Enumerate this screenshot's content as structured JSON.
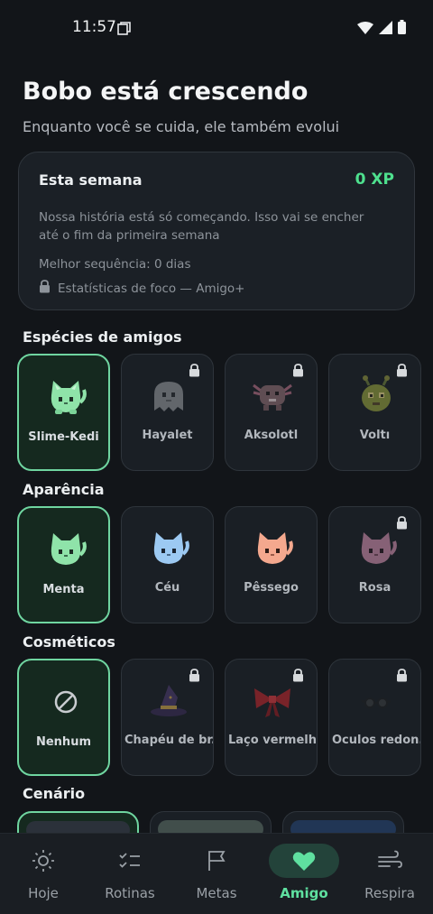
{
  "status_bar": {
    "time": "11:57"
  },
  "header": {
    "title": "Bobo está crescendo",
    "subtitle": "Enquanto você se cuida, ele também evolui"
  },
  "week_card": {
    "title": "Esta semana",
    "xp": "0 XP",
    "description": "Nossa história está só começando. Isso vai se encher até o fim da primeira semana",
    "streak": "Melhor sequência: 0 dias",
    "locked_feature": "Estatísticas de foco — Amigo+"
  },
  "sections": {
    "species": "Espécies de amigos",
    "appearance": "Aparência",
    "cosmetics": "Cosméticos",
    "scenery": "Cenário"
  },
  "species": [
    {
      "label": "Slime-Kedi",
      "icon": "green-cat-icon",
      "selected": true,
      "locked": false
    },
    {
      "label": "Hayalet",
      "icon": "ghost-icon",
      "selected": false,
      "locked": true
    },
    {
      "label": "Aksolotl",
      "icon": "axolotl-icon",
      "selected": false,
      "locked": true
    },
    {
      "label": "Voltı",
      "icon": "alien-icon",
      "selected": false,
      "locked": true
    }
  ],
  "appearance": [
    {
      "label": "Menta",
      "icon": "mint-cat-icon",
      "selected": true,
      "locked": false,
      "color": "#8fe3a9"
    },
    {
      "label": "Céu",
      "icon": "sky-cat-icon",
      "selected": false,
      "locked": false,
      "color": "#9cc9f2"
    },
    {
      "label": "Pêssego",
      "icon": "peach-cat-icon",
      "selected": false,
      "locked": false,
      "color": "#f4a88e"
    },
    {
      "label": "Rosa",
      "icon": "rose-cat-icon",
      "selected": false,
      "locked": true,
      "color": "#c98aa8"
    }
  ],
  "cosmetics": [
    {
      "label": "Nenhum",
      "icon": "none-icon",
      "selected": true,
      "locked": false
    },
    {
      "label": "Chapéu de br...",
      "icon": "witch-hat-icon",
      "selected": false,
      "locked": true
    },
    {
      "label": "Laço vermelho",
      "icon": "red-bow-icon",
      "selected": false,
      "locked": true
    },
    {
      "label": "Óculos redon...",
      "icon": "round-glasses-icon",
      "selected": false,
      "locked": true
    }
  ],
  "nav": [
    {
      "label": "Hoje",
      "icon": "sun-icon",
      "active": false
    },
    {
      "label": "Rotinas",
      "icon": "checklist-icon",
      "active": false
    },
    {
      "label": "Metas",
      "icon": "flag-icon",
      "active": false
    },
    {
      "label": "Amigo",
      "icon": "heart-icon",
      "active": true
    },
    {
      "label": "Respira",
      "icon": "wind-icon",
      "active": false
    }
  ],
  "colors": {
    "background": "#121519",
    "accent": "#6fd5a0",
    "xp": "#4ee08e",
    "nav_active": "#5fe0a0"
  }
}
